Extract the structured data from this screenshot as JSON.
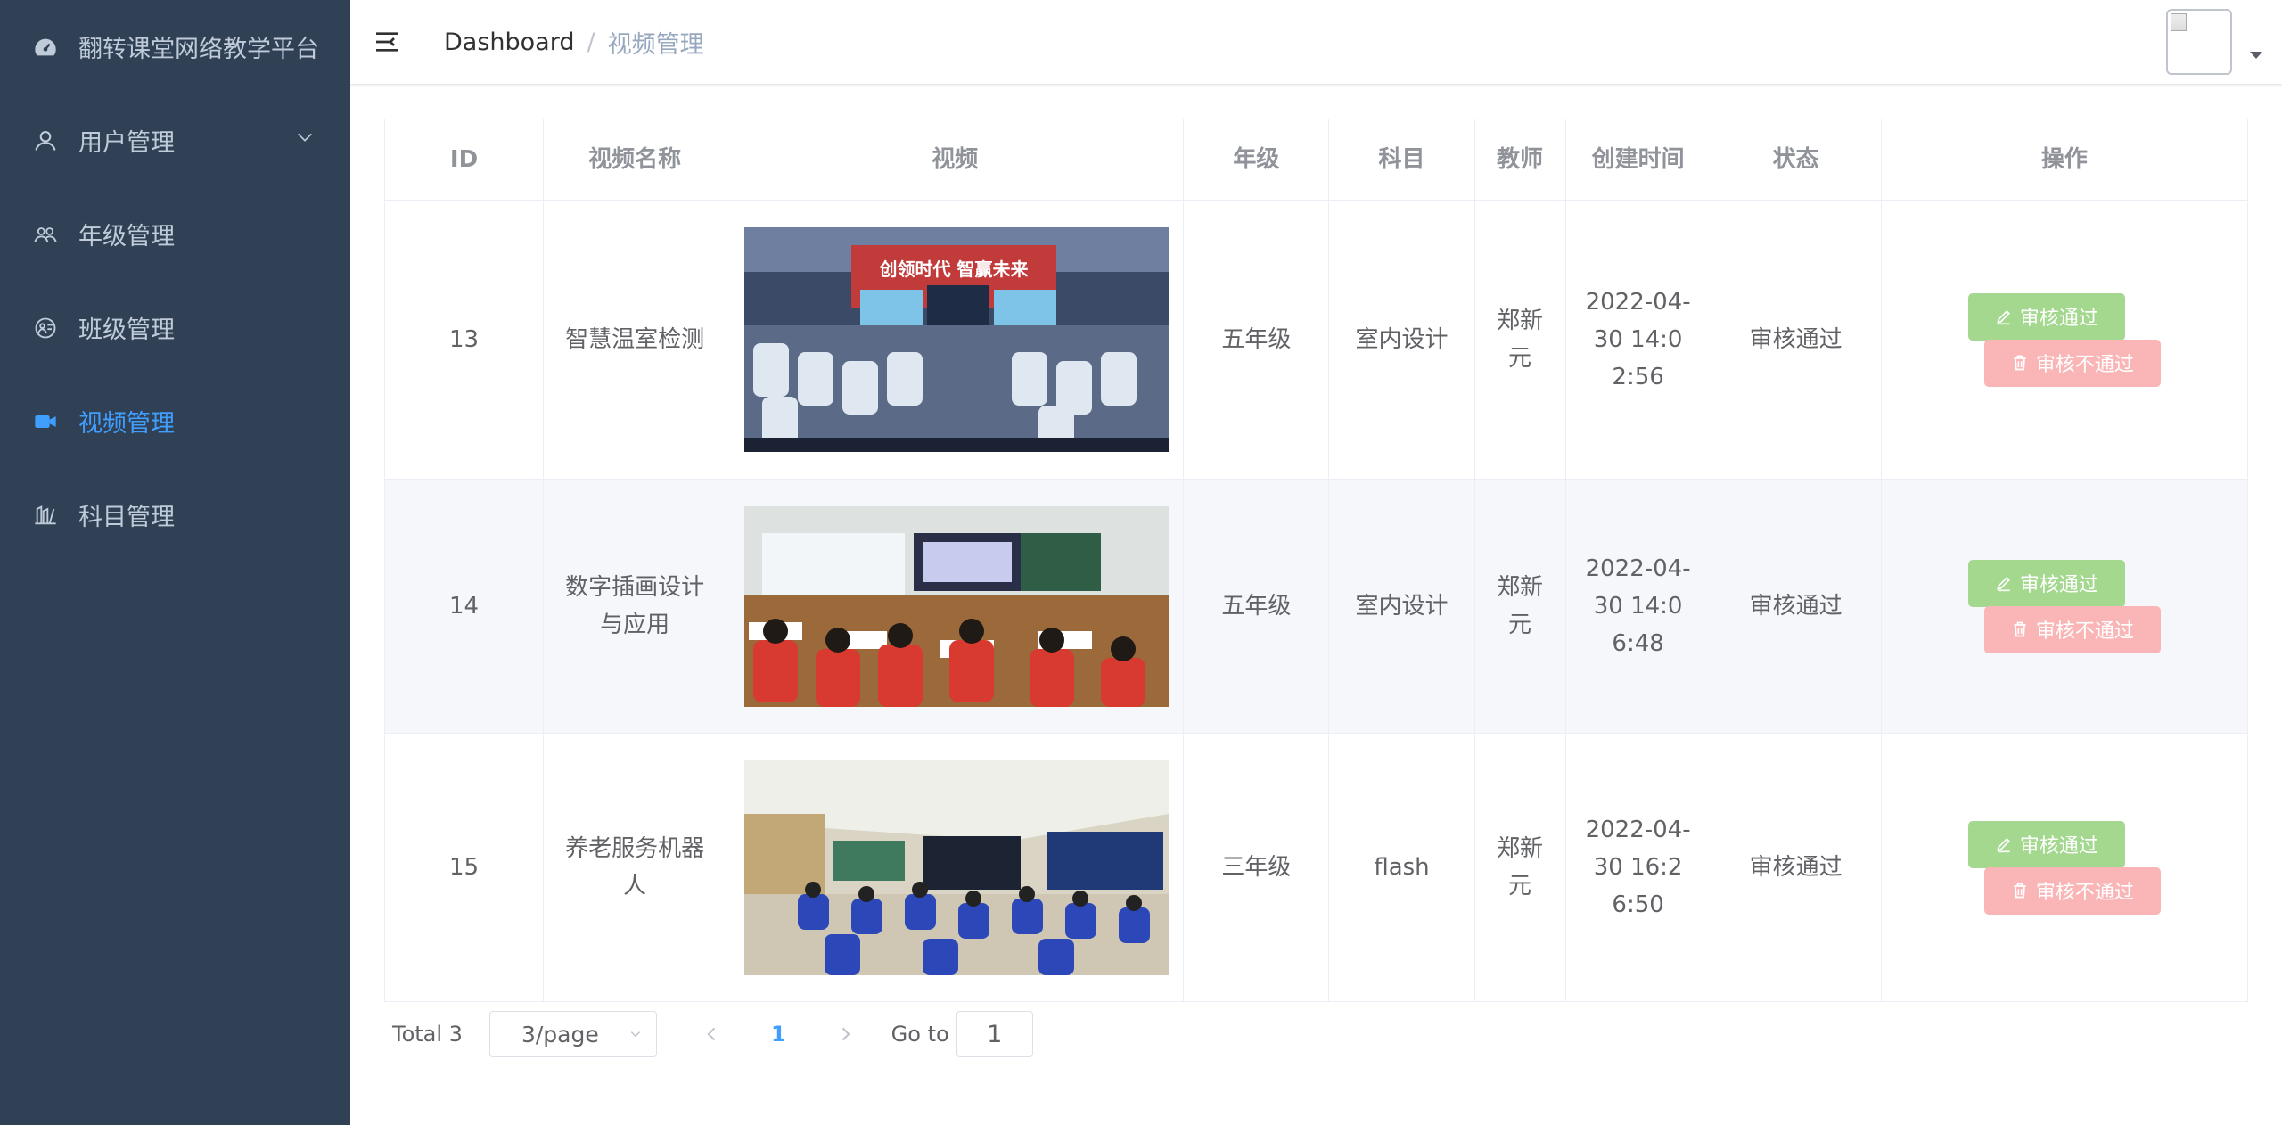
{
  "sidebar": {
    "title": "翻转课堂网络教学平台",
    "items": [
      {
        "label": "用户管理",
        "icon": "user-icon",
        "has_submenu": true
      },
      {
        "label": "年级管理",
        "icon": "users-icon"
      },
      {
        "label": "班级管理",
        "icon": "class-icon"
      },
      {
        "label": "视频管理",
        "icon": "video-camera-icon",
        "active": true
      },
      {
        "label": "科目管理",
        "icon": "subject-icon"
      }
    ],
    "colors": {
      "bg": "#304156",
      "text": "#bfcbd9",
      "active": "#409eff"
    }
  },
  "navbar": {
    "breadcrumb": {
      "home": "Dashboard",
      "separator": "/",
      "current": "视频管理"
    }
  },
  "table": {
    "headers": {
      "id": "ID",
      "name": "视频名称",
      "video": "视频",
      "grade": "年级",
      "subject": "科目",
      "teacher": "教师",
      "created": "创建时间",
      "status": "状态",
      "action": "操作"
    },
    "rows": [
      {
        "id": "13",
        "name": "智慧温室检测",
        "grade": "五年级",
        "subject": "室内设计",
        "teacher": "郑新元",
        "created": "2022-04-30 14:02:56",
        "status": "审核通过",
        "approve": "审核通过",
        "reject": "审核不通过",
        "banner": "创领时代 智赢未来"
      },
      {
        "id": "14",
        "name": "数字插画设计与应用",
        "grade": "五年级",
        "subject": "室内设计",
        "teacher": "郑新元",
        "created": "2022-04-30 14:06:48",
        "status": "审核通过",
        "approve": "审核通过",
        "reject": "审核不通过"
      },
      {
        "id": "15",
        "name": "养老服务机器人",
        "grade": "三年级",
        "subject": "flash",
        "teacher": "郑新元",
        "created": "2022-04-30 16:26:50",
        "status": "审核通过",
        "approve": "审核通过",
        "reject": "审核不通过"
      }
    ]
  },
  "pagination": {
    "total_label": "Total 3",
    "page_size": "3/page",
    "current_page": "1",
    "goto_label": "Go to",
    "goto_value": "1"
  },
  "colors": {
    "approve": "#a3d88e",
    "reject": "#fab6b6",
    "accent": "#409eff"
  }
}
